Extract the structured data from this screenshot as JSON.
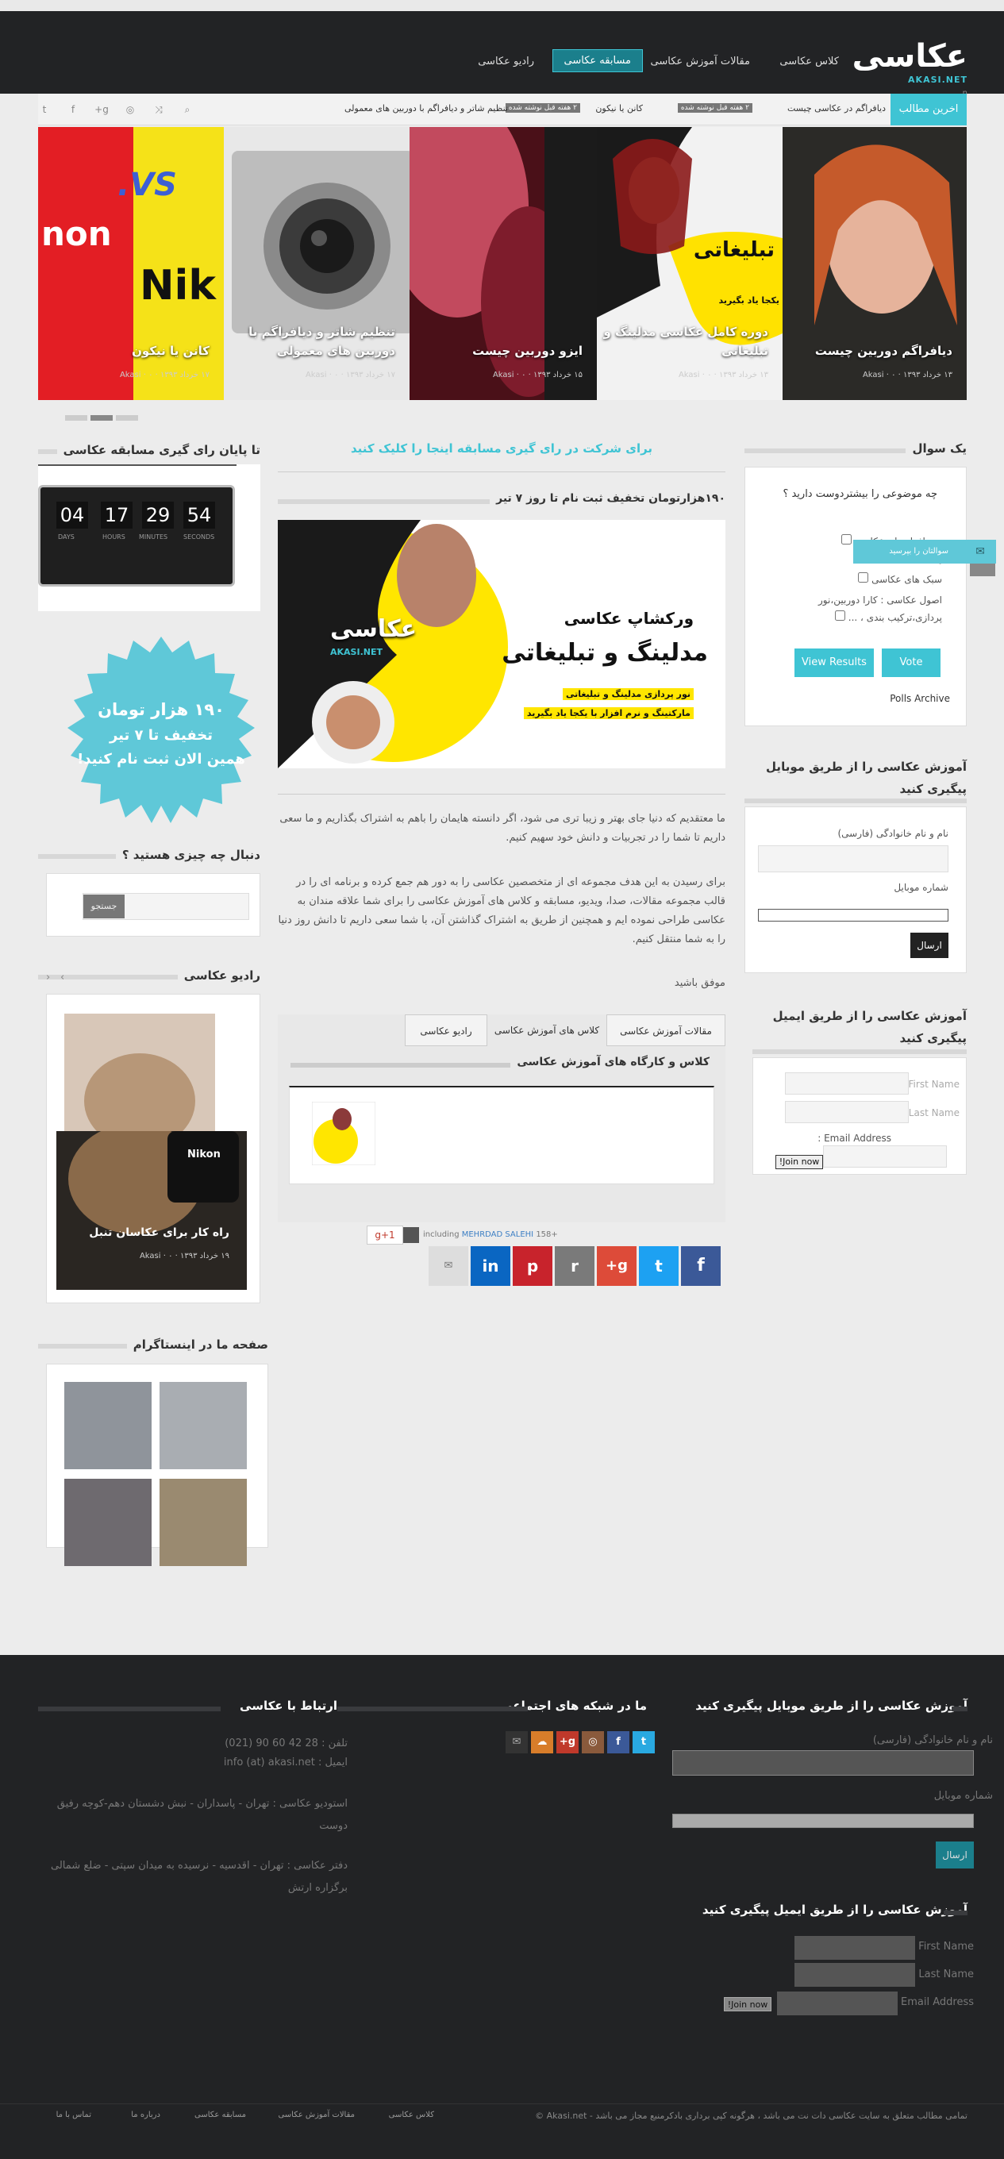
{
  "header": {
    "logo_text": "عکاسی",
    "logo_sub": "AKASI.NET",
    "logo_small": "n",
    "nav": [
      "کلاس عکاسی",
      "مقالات آموزش عکاسی",
      "مسابقه عکاسی",
      "رادیو عکاسی"
    ]
  },
  "ticker": {
    "label": "اخرین مطالب",
    "items": [
      {
        "text": "دیافراگم در عکاسی چیست",
        "badge": "۲ هفته قبل نوشته شده"
      },
      {
        "text": "کانن یا نیکون",
        "badge": "۲ هفته قبل نوشته شده"
      },
      {
        "text": "تنظیم شاتر و دیافراگم با دوربین های معمولی",
        "badge": ""
      }
    ]
  },
  "slider": {
    "slides": [
      {
        "title": "دیافراگم دوربین چیست",
        "author": "Akasi",
        "date": "۱۳ خرداد ۱۳۹۳",
        "comments": "۰",
        "color": "#c9a38d"
      },
      {
        "title": "دوره کامل عکاسی مدلینگ و تبلیغاتی",
        "author": "Akasi",
        "date": "۱۳ خرداد ۱۳۹۳",
        "comments": "۰",
        "color": "#d8b322"
      },
      {
        "title": "ایزو دوربین چیست",
        "author": "Akasi",
        "date": "۱۵ خرداد ۱۳۹۳",
        "comments": "۰",
        "color": "#9a2b3a"
      },
      {
        "title": "تنظیم شاتر و دیافراگم با دوربین های معمولی",
        "author": "Akasi",
        "date": "۱۷ خرداد ۱۳۹۳",
        "comments": "۰",
        "color": "#9b9b9b"
      },
      {
        "title": "کانن یا نیکون",
        "author": "Akasi",
        "date": "۱۷ خرداد ۱۳۹۳",
        "comments": "۰",
        "color": "#e8d826"
      }
    ],
    "slide_texts": {
      "vs": "VS.",
      "canon": "non",
      "nikon": "Nik",
      "ad_head": "تبلیغاتی",
      "ad_sub": "یکجا یاد بگیرید",
      "ad_mid": "ها"
    }
  },
  "left_col": {
    "countdown_title": "تا پایان رای گیری مسابقه عکاسی",
    "countdown": {
      "days": "04",
      "hours": "17",
      "minutes": "29",
      "seconds": "54",
      "l_days": "DAYS",
      "l_hours": "HOURS",
      "l_min": "MINUTES",
      "l_sec": "SECONDS"
    },
    "badge_lines": [
      "۱۹۰ هزار تومان",
      "تخفیف تا ۷ تیر",
      "همین الان ثبت نام کنید!"
    ],
    "search_title": "دنبال چه چیزی هستید ؟",
    "search_btn": "جستجو",
    "radio_title": "رادیو عکاسی",
    "radio_post": {
      "title": "راه کار برای عکاسان تنبل",
      "author": "Akasi",
      "date": "۱۹ خرداد ۱۳۹۳",
      "comments": "۰",
      "brand": "Nikon"
    },
    "insta_title": "صفحه ما در اینستاگرام"
  },
  "center": {
    "promo_link": "برای شرکت در رای گیری مسابقه اینجا را کلیک کنید",
    "post_title": "۱۹۰هزارتومان تخفیف ثبت نام تا روز ۷ تیر",
    "promo_img": {
      "brand": "عکاسی",
      "brand_sub": "AKASI.NET",
      "workshop": "ورکشاپ عکاسی",
      "main": "مدلینگ و تبلیغاتی",
      "line1": "نور پردازی مدلینگ و تبلیغاتی",
      "line2": "مارکتینگ و نرم افزار با یکجا یاد بگیرید"
    },
    "para1": "ما معتقدیم که دنیا جای بهتر و زیبا تری می شود، اگر دانسته هایمان را باهم به اشتراک بگذاریم و ما سعی داریم تا شما را در تجربیات و دانش خود سهیم کنیم.",
    "para2": "برای رسیدن به این هدف مجموعه ای از متخصصین عکاسی را به دور هم جمع کرده و برنامه ای را در قالب مجموعه مقالات، صدا، ویدیو، مسابقه و کلاس های آموزش عکاسی را برای شما علاقه مندان به عکاسی طراحی نموده ایم و همچنین از طریق به اشتراک گذاشتن آن، با شما سعی داریم تا دانش روز دنیا را به شما منتقل کنیم.",
    "signoff": "موفق باشید",
    "tabs": [
      "مقالات آموزش عکاسی",
      "کلاس های آموزش عکاسی",
      "رادیو عکاسی"
    ],
    "tab_heading": "کلاس و کارگاه های آموزش عکاسی",
    "gplus": {
      "count": "+158 including",
      "name": "MEHRDAD SALEHI",
      "label": "g+1"
    },
    "share_icons": [
      "f",
      "t",
      "g+",
      "r",
      "p",
      "in",
      "✉"
    ]
  },
  "right_col": {
    "poll_title": "یک سوال",
    "poll_q": "چه موضوعی را بیشتردوست دارید ؟",
    "poll_opts": [
      "نرم افزار های عکاسی",
      "ها",
      "سبک های عکاسی",
      "اصول عکاسی : کارا دوربین،نور پردازی،ترکیب بندی ، ..."
    ],
    "poll_vote": "Vote",
    "poll_results": "View Results",
    "poll_archive": "Polls Archive",
    "floating_label": "سوالتان را بپرسید",
    "mobile_title": "آموزش عکاسی را از طریق موبایل پیگیری کنید",
    "mobile_name": "نام و نام خانوادگی (فارسی)",
    "mobile_phone": "شماره موبایل",
    "mobile_send": "ارسال",
    "email_title": "آموزش عکاسی را از طریق ایمیل پیگیری کنید",
    "email_first": "First Name :",
    "email_last": "Last Name :",
    "email_addr": "Email Address :",
    "email_join": "Join now!"
  },
  "footer": {
    "mobile_title": "آموزش عکاسی را از طریق موبایل پیگیری کنید",
    "mobile_name": "نام و نام خانوادگی (فارسی)",
    "mobile_phone": "شماره موبایل",
    "mobile_send": "ارسال",
    "social_title": "ما در شبکه های اجتماعی",
    "social": [
      {
        "t": "t",
        "c": "#29a9e1"
      },
      {
        "t": "f",
        "c": "#3b5998"
      },
      {
        "t": "◎",
        "c": "#8a5a3c"
      },
      {
        "t": "g+",
        "c": "#c0392b"
      },
      {
        "t": "☁",
        "c": "#d87d2a"
      },
      {
        "t": "✉",
        "c": "#333"
      }
    ],
    "contact_title": "ارتباط با عکاسی",
    "contact_lines": [
      "تلفن : 28 42 60 90 (021)",
      "ایمیل : info (at) akasi.net",
      "",
      "استودیو عکاسی : تهران - پاسداران - نبش دشستان دهم-کوچه رفیق دوست",
      "",
      "دفتر عکاسی : تهران - اقدسیه - نرسیده به میدان سپتی - ضلع شمالی برگزاره ارتش"
    ],
    "email_title": "آموزش عکاسی را از طریق ایمیل پیگیری کنید",
    "email_first": "First Name :",
    "email_last": "Last Name :",
    "email_addr": "Email Address :",
    "email_join": "Join now!",
    "copyright": "تمامی مطالب متعلق به سایت عکاسی دات نت می باشد ، هرگونه کپی برداری بادکرمنبع مجاز می باشد - Akasi.net ©",
    "links": [
      "کلاس عکاسی",
      "مقالات آموزش عکاسی",
      "مسابقه عکاسی",
      "درباره ما",
      "تماس با ما"
    ]
  }
}
